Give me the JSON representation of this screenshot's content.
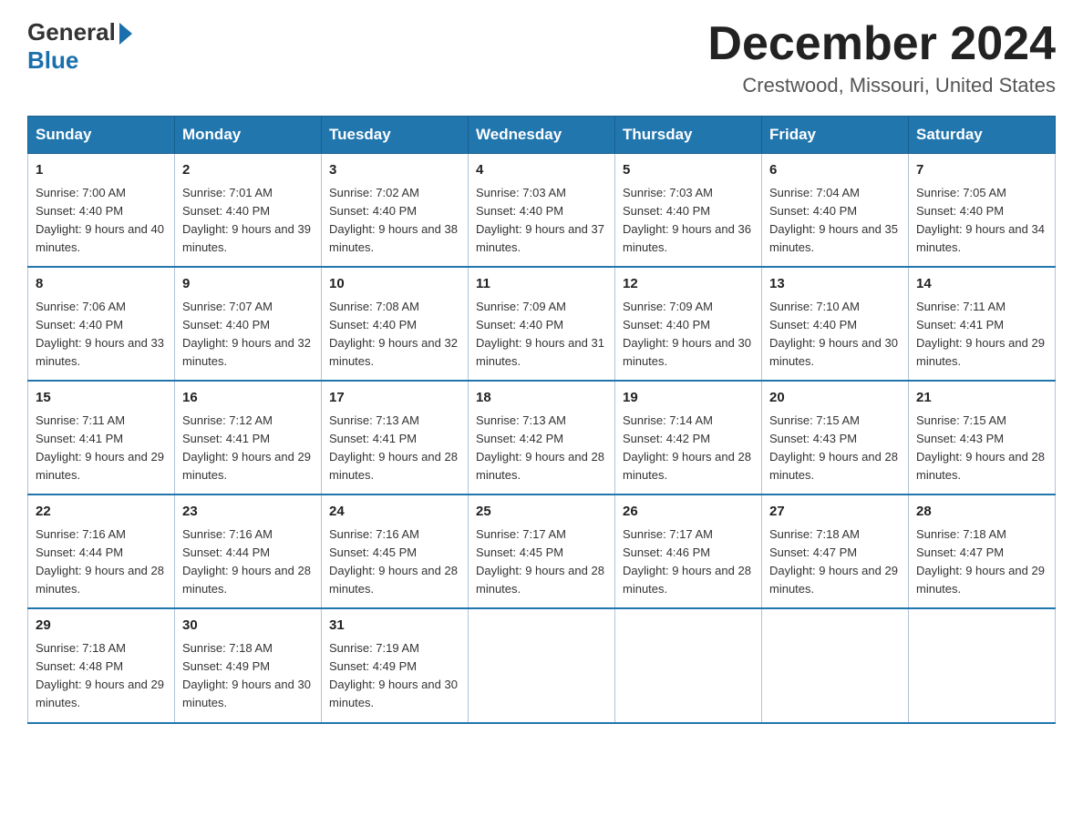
{
  "logo": {
    "general": "General",
    "blue": "Blue"
  },
  "header": {
    "month": "December 2024",
    "location": "Crestwood, Missouri, United States"
  },
  "weekdays": [
    "Sunday",
    "Monday",
    "Tuesday",
    "Wednesday",
    "Thursday",
    "Friday",
    "Saturday"
  ],
  "weeks": [
    [
      {
        "day": "1",
        "sunrise": "7:00 AM",
        "sunset": "4:40 PM",
        "daylight": "9 hours and 40 minutes."
      },
      {
        "day": "2",
        "sunrise": "7:01 AM",
        "sunset": "4:40 PM",
        "daylight": "9 hours and 39 minutes."
      },
      {
        "day": "3",
        "sunrise": "7:02 AM",
        "sunset": "4:40 PM",
        "daylight": "9 hours and 38 minutes."
      },
      {
        "day": "4",
        "sunrise": "7:03 AM",
        "sunset": "4:40 PM",
        "daylight": "9 hours and 37 minutes."
      },
      {
        "day": "5",
        "sunrise": "7:03 AM",
        "sunset": "4:40 PM",
        "daylight": "9 hours and 36 minutes."
      },
      {
        "day": "6",
        "sunrise": "7:04 AM",
        "sunset": "4:40 PM",
        "daylight": "9 hours and 35 minutes."
      },
      {
        "day": "7",
        "sunrise": "7:05 AM",
        "sunset": "4:40 PM",
        "daylight": "9 hours and 34 minutes."
      }
    ],
    [
      {
        "day": "8",
        "sunrise": "7:06 AM",
        "sunset": "4:40 PM",
        "daylight": "9 hours and 33 minutes."
      },
      {
        "day": "9",
        "sunrise": "7:07 AM",
        "sunset": "4:40 PM",
        "daylight": "9 hours and 32 minutes."
      },
      {
        "day": "10",
        "sunrise": "7:08 AM",
        "sunset": "4:40 PM",
        "daylight": "9 hours and 32 minutes."
      },
      {
        "day": "11",
        "sunrise": "7:09 AM",
        "sunset": "4:40 PM",
        "daylight": "9 hours and 31 minutes."
      },
      {
        "day": "12",
        "sunrise": "7:09 AM",
        "sunset": "4:40 PM",
        "daylight": "9 hours and 30 minutes."
      },
      {
        "day": "13",
        "sunrise": "7:10 AM",
        "sunset": "4:40 PM",
        "daylight": "9 hours and 30 minutes."
      },
      {
        "day": "14",
        "sunrise": "7:11 AM",
        "sunset": "4:41 PM",
        "daylight": "9 hours and 29 minutes."
      }
    ],
    [
      {
        "day": "15",
        "sunrise": "7:11 AM",
        "sunset": "4:41 PM",
        "daylight": "9 hours and 29 minutes."
      },
      {
        "day": "16",
        "sunrise": "7:12 AM",
        "sunset": "4:41 PM",
        "daylight": "9 hours and 29 minutes."
      },
      {
        "day": "17",
        "sunrise": "7:13 AM",
        "sunset": "4:41 PM",
        "daylight": "9 hours and 28 minutes."
      },
      {
        "day": "18",
        "sunrise": "7:13 AM",
        "sunset": "4:42 PM",
        "daylight": "9 hours and 28 minutes."
      },
      {
        "day": "19",
        "sunrise": "7:14 AM",
        "sunset": "4:42 PM",
        "daylight": "9 hours and 28 minutes."
      },
      {
        "day": "20",
        "sunrise": "7:15 AM",
        "sunset": "4:43 PM",
        "daylight": "9 hours and 28 minutes."
      },
      {
        "day": "21",
        "sunrise": "7:15 AM",
        "sunset": "4:43 PM",
        "daylight": "9 hours and 28 minutes."
      }
    ],
    [
      {
        "day": "22",
        "sunrise": "7:16 AM",
        "sunset": "4:44 PM",
        "daylight": "9 hours and 28 minutes."
      },
      {
        "day": "23",
        "sunrise": "7:16 AM",
        "sunset": "4:44 PM",
        "daylight": "9 hours and 28 minutes."
      },
      {
        "day": "24",
        "sunrise": "7:16 AM",
        "sunset": "4:45 PM",
        "daylight": "9 hours and 28 minutes."
      },
      {
        "day": "25",
        "sunrise": "7:17 AM",
        "sunset": "4:45 PM",
        "daylight": "9 hours and 28 minutes."
      },
      {
        "day": "26",
        "sunrise": "7:17 AM",
        "sunset": "4:46 PM",
        "daylight": "9 hours and 28 minutes."
      },
      {
        "day": "27",
        "sunrise": "7:18 AM",
        "sunset": "4:47 PM",
        "daylight": "9 hours and 29 minutes."
      },
      {
        "day": "28",
        "sunrise": "7:18 AM",
        "sunset": "4:47 PM",
        "daylight": "9 hours and 29 minutes."
      }
    ],
    [
      {
        "day": "29",
        "sunrise": "7:18 AM",
        "sunset": "4:48 PM",
        "daylight": "9 hours and 29 minutes."
      },
      {
        "day": "30",
        "sunrise": "7:18 AM",
        "sunset": "4:49 PM",
        "daylight": "9 hours and 30 minutes."
      },
      {
        "day": "31",
        "sunrise": "7:19 AM",
        "sunset": "4:49 PM",
        "daylight": "9 hours and 30 minutes."
      },
      null,
      null,
      null,
      null
    ]
  ],
  "labels": {
    "sunrise": "Sunrise:",
    "sunset": "Sunset:",
    "daylight": "Daylight:"
  }
}
